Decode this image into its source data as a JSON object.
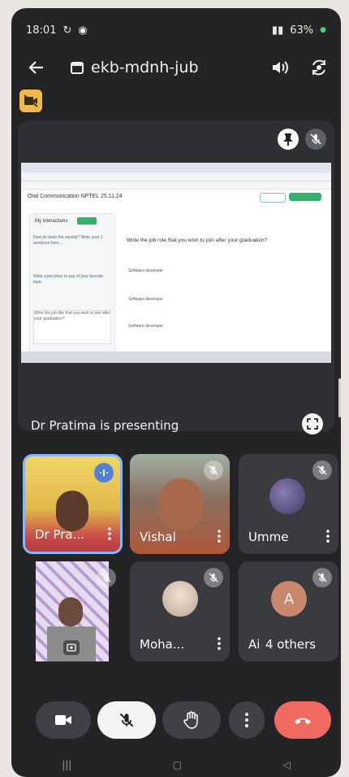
{
  "status_bar": {
    "time": "18:01",
    "battery": "63%"
  },
  "app_bar": {
    "meeting_code": "ekb-mdnh-jub"
  },
  "presentation": {
    "shared_screen": {
      "page_title": "Oral Communication NPTEL 25.11.24",
      "sidebar_title": "My interactions",
      "questions": [
        "How do learn the weekly? Write your 1 sentence here...",
        "Write a few lines to say of your favorite topic",
        "Write the job title that you wish to join after your graduation?"
      ],
      "prompt": "Write the job role that you wish to join after your graduation?",
      "answers": [
        "Software developer",
        "Software developer",
        "Software developer"
      ]
    },
    "presenting_label": "Dr Pratima is presenting"
  },
  "participants": [
    {
      "name": "Dr Pra...",
      "muted": false,
      "speaking": true
    },
    {
      "name": "Vishal",
      "muted": true
    },
    {
      "name": "Umme",
      "muted": true
    },
    {
      "name": "",
      "muted": true
    },
    {
      "name": "Moha...",
      "muted": true
    },
    {
      "name": "Ai",
      "muted": true,
      "avatar_letter": "A",
      "others_label": "4 others"
    }
  ],
  "icons": {
    "back": "arrow-left-icon",
    "calendar": "calendar-icon",
    "speaker": "speaker-icon",
    "switch_camera": "switch-camera-icon",
    "camera_off": "camera-off-icon",
    "pin": "pin-icon",
    "mic_off": "mic-off-icon",
    "fullscreen": "fullscreen-icon",
    "camera": "camera-icon",
    "raise_hand": "raise-hand-icon",
    "more": "more-vert-icon",
    "end_call": "end-call-icon"
  },
  "colors": {
    "end_call": "#f06a62",
    "active_speaker_border": "#8ab4f8",
    "notice": "#f1b84a"
  }
}
